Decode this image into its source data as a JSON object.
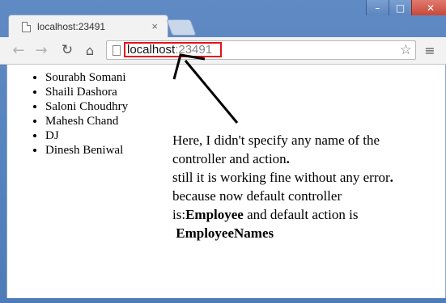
{
  "browser": {
    "tab_title": "localhost:23491",
    "tab_close": "×",
    "url_host": "localhost",
    "url_port": ":23491",
    "window_controls": {
      "minimize": "–",
      "maximize": "□",
      "close": "✕"
    },
    "toolbar_icons": {
      "back": "←",
      "forward": "→",
      "reload": "↻",
      "home": "⌂",
      "star": "☆",
      "menu": "≡"
    }
  },
  "list": {
    "items": [
      "Sourabh Somani",
      "Shaili Dashora",
      "Saloni Choudhry",
      "Mahesh Chand",
      "DJ",
      "Dinesh Beniwal"
    ]
  },
  "annotation": {
    "line1": "Here, I didn't specify any name of the",
    "line2": "controller and action",
    "line3": "still it is working fine without any error",
    "line4": "because now default controller",
    "line5_prefix": "is:",
    "line5_bold": "Employee",
    "line5_suffix": " and default action is",
    "line6_bold": "EmployeeNames"
  },
  "colors": {
    "highlight": "#e8101a",
    "frame": "#5f8ac4"
  }
}
